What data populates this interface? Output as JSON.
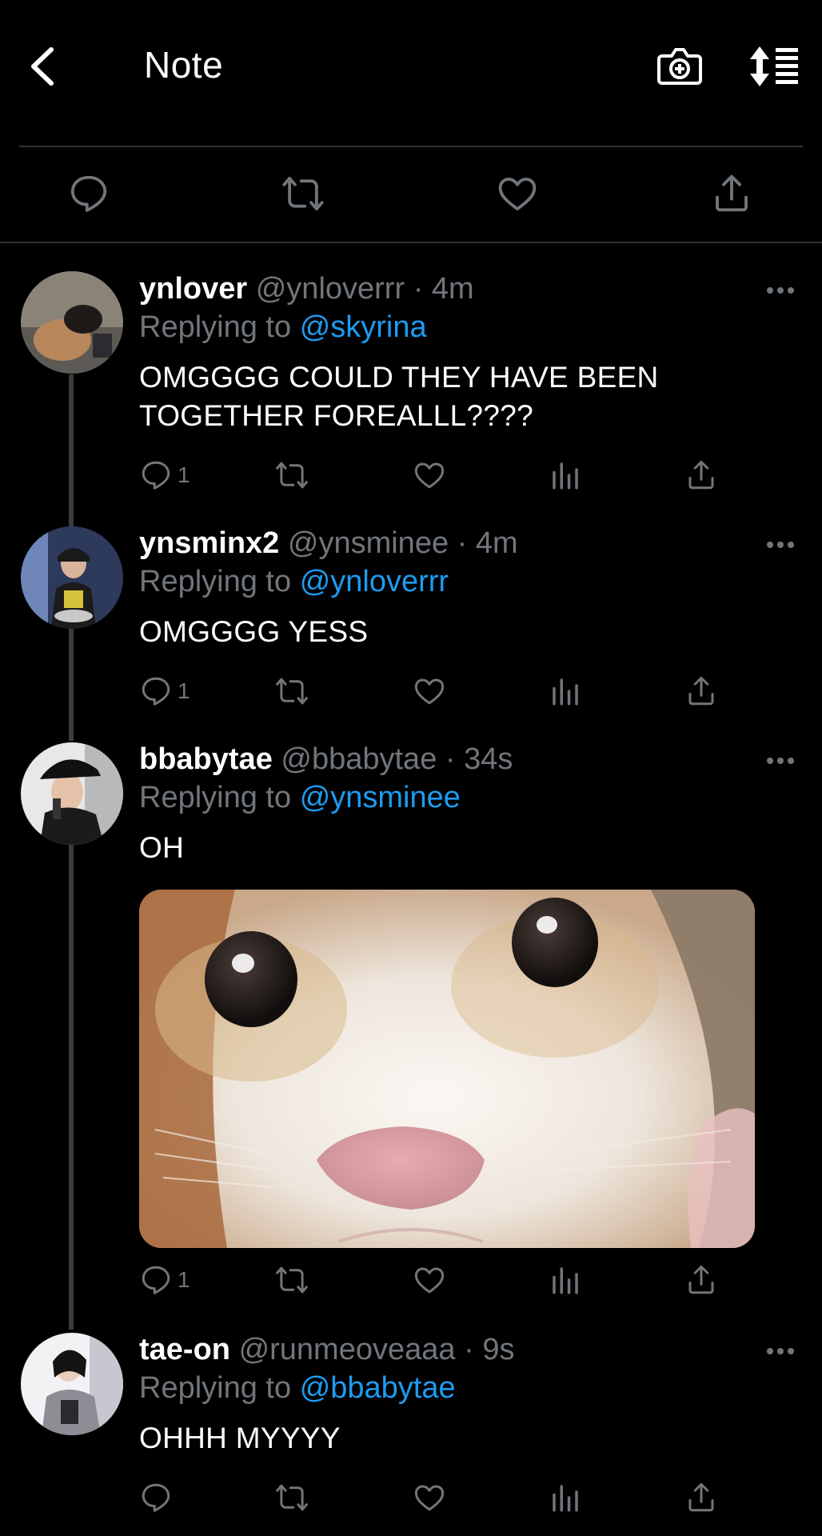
{
  "header": {
    "title": "Note",
    "back_icon": "chevron-left-icon",
    "camera_icon": "camera-add-icon",
    "sort_icon": "sort-icon"
  },
  "action_bar": {
    "icons": [
      "reply-icon",
      "retweet-icon",
      "like-icon",
      "share-icon"
    ]
  },
  "colors": {
    "background": "#000000",
    "accent": "#1d9bf0",
    "muted": "#71767b",
    "divider": "#2f3336"
  },
  "replies": [
    {
      "name": "ynlover",
      "handle": "@ynloverrr",
      "sep": "·",
      "time": "4m",
      "replying_prefix": "Replying to",
      "replying_to": "@skyrina",
      "text_lines": [
        "OMGGGG COULD THEY HAVE BEEN",
        "TOGETHER FOREALLL????"
      ],
      "reply_count": "1"
    },
    {
      "name": "ynsminx2",
      "handle": "@ynsminee",
      "sep": "·",
      "time": "4m",
      "replying_prefix": "Replying to",
      "replying_to": "@ynloverrr",
      "text_lines": [
        "OMGGGG YESS"
      ],
      "reply_count": "1"
    },
    {
      "name": "bbabytae",
      "handle": "@bbabytae",
      "sep": "·",
      "time": "34s",
      "replying_prefix": "Replying to",
      "replying_to": "@ynsminee",
      "text_lines": [
        "OH"
      ],
      "reply_count": "1",
      "media": "cat-closeup-image"
    },
    {
      "name": "tae-on",
      "handle": "@runmeoveaaa",
      "sep": "·",
      "time": "9s",
      "replying_prefix": "Replying to",
      "replying_to": "@bbabytae",
      "text_lines": [
        "OHHH MYYYY"
      ],
      "reply_count": ""
    }
  ]
}
